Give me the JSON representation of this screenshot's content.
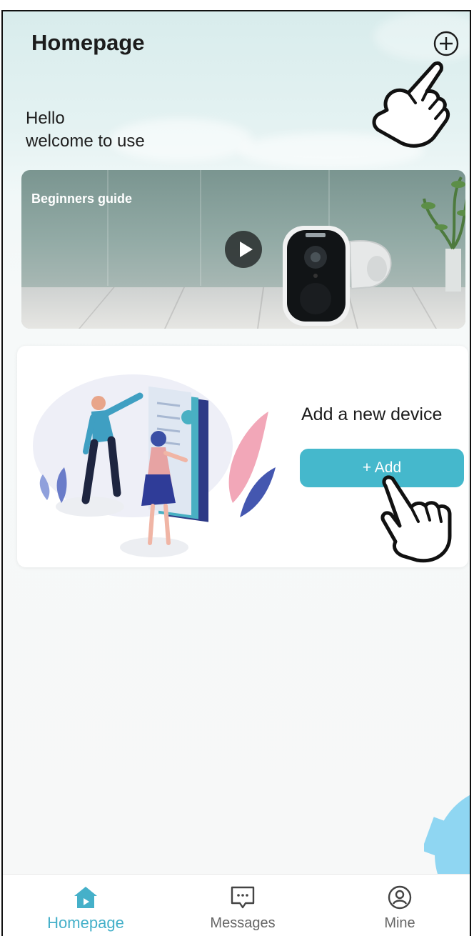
{
  "header": {
    "title": "Homepage",
    "add_icon": "plus-circle-icon"
  },
  "greeting": {
    "line1": "Hello",
    "line2": "welcome to use"
  },
  "banner": {
    "label": "Beginners guide",
    "play_icon": "play-icon"
  },
  "device_card": {
    "title": "Add a new device",
    "add_label": "+ Add"
  },
  "tab_bar": {
    "tabs": [
      {
        "label": "Homepage",
        "icon": "home-icon",
        "active": true
      },
      {
        "label": "Messages",
        "icon": "message-icon",
        "active": false
      },
      {
        "label": "Mine",
        "icon": "profile-icon",
        "active": false
      }
    ]
  },
  "colors": {
    "accent": "#45b8cc",
    "active_tab": "#45b0c9",
    "inactive_tab": "#666666"
  }
}
